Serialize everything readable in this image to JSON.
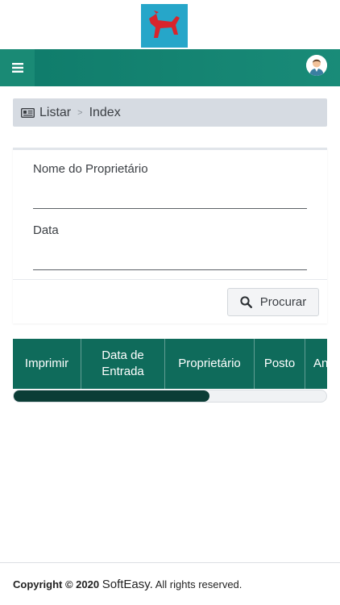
{
  "app": {
    "logo_icon": "red-horse-logo",
    "menu_icon": "hamburger-icon",
    "avatar_icon": "user-avatar-icon",
    "accent_color": "#0f7b6a"
  },
  "breadcrumb": {
    "icon": "list-card-icon",
    "root": "Listar",
    "separator": ">",
    "current": "Index"
  },
  "filters": {
    "owner_label": "Nome do Proprietário",
    "owner_value": "",
    "date_label": "Data",
    "date_value": "",
    "search_button": "Procurar",
    "search_icon": "magnifier-icon"
  },
  "table": {
    "columns": [
      "Imprimir",
      "Data de Entrada",
      "Proprietário",
      "Posto",
      "An"
    ]
  },
  "scroll": {
    "position_fraction": 0.62
  },
  "footer": {
    "copyright": "Copyright © 2020",
    "brand": "SoftEasy.",
    "rights": "All rights reserved."
  }
}
